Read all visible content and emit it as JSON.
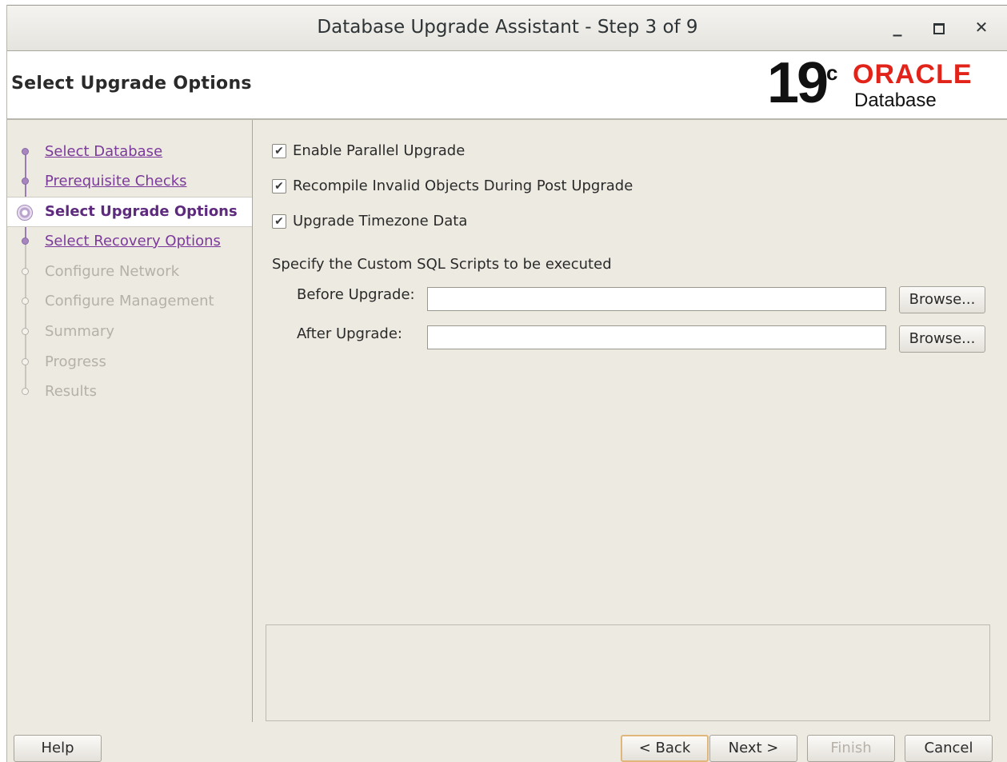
{
  "window": {
    "title": "Database Upgrade Assistant - Step 3 of 9",
    "minimize_glyph": "_",
    "maximize_glyph": "▫",
    "close_glyph": "✕"
  },
  "header": {
    "page_title": "Select Upgrade Options",
    "logo": {
      "version": "19",
      "version_suffix": "c",
      "brand": "ORACLE",
      "product": "Database",
      "brand_color": "#e2231a"
    }
  },
  "steps": [
    {
      "label": "Select Database",
      "state": "done"
    },
    {
      "label": "Prerequisite Checks",
      "state": "done"
    },
    {
      "label": "Select Upgrade Options",
      "state": "current"
    },
    {
      "label": "Select Recovery Options",
      "state": "done"
    },
    {
      "label": "Configure Network",
      "state": "todo"
    },
    {
      "label": "Configure Management",
      "state": "todo"
    },
    {
      "label": "Summary",
      "state": "todo"
    },
    {
      "label": "Progress",
      "state": "todo"
    },
    {
      "label": "Results",
      "state": "todo"
    }
  ],
  "options": {
    "parallel": {
      "label": "Enable Parallel Upgrade",
      "checked": true
    },
    "recompile": {
      "label": "Recompile Invalid Objects During Post Upgrade",
      "checked": true
    },
    "timezone": {
      "label": "Upgrade Timezone Data",
      "checked": true
    }
  },
  "scripts": {
    "section_label": "Specify the Custom SQL Scripts to be executed",
    "before": {
      "label": "Before Upgrade:",
      "value": "",
      "browse_label": "Browse..."
    },
    "after": {
      "label": "After Upgrade:",
      "value": "",
      "browse_label": "Browse..."
    }
  },
  "footer": {
    "help": "Help",
    "back": "< Back",
    "next": "Next >",
    "finish": "Finish",
    "cancel": "Cancel"
  },
  "colors": {
    "accent_purple": "#7b3a9b",
    "panel_bg": "#edeae1"
  }
}
